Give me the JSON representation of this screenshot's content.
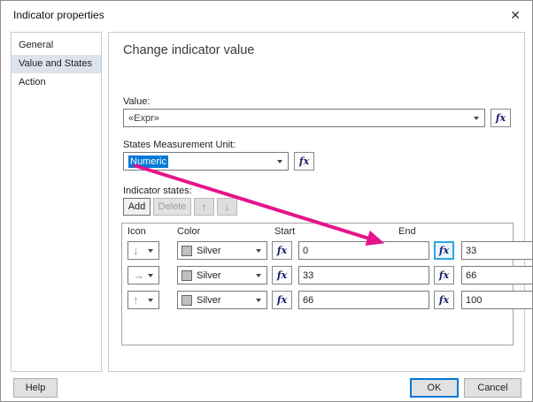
{
  "window": {
    "title": "Indicator properties",
    "close_icon": "✕"
  },
  "sidebar": {
    "items": [
      {
        "label": "General"
      },
      {
        "label": "Value and States"
      },
      {
        "label": "Action"
      }
    ]
  },
  "main": {
    "heading": "Change indicator value",
    "fx_label": "fx",
    "value": {
      "label": "Value:",
      "text": "«Expr»"
    },
    "unit": {
      "label": "States Measurement Unit:",
      "value": "Numeric"
    },
    "states": {
      "label": "Indicator states:",
      "add_label": "Add",
      "delete_label": "Delete",
      "up_icon": "↑",
      "down_icon": "↓",
      "headers": {
        "icon": "Icon",
        "color": "Color",
        "start": "Start",
        "end": "End"
      },
      "rows": [
        {
          "icon_glyph": "↓",
          "color": "Silver",
          "start": "0",
          "end": "33"
        },
        {
          "icon_glyph": "→",
          "color": "Silver",
          "start": "33",
          "end": "66"
        },
        {
          "icon_glyph": "↑",
          "color": "Silver",
          "start": "66",
          "end": "100"
        }
      ]
    }
  },
  "footer": {
    "help_label": "Help",
    "ok_label": "OK",
    "cancel_label": "Cancel"
  },
  "colors": {
    "annotation_arrow": "#e5148c",
    "selection_blue": "#0078d7",
    "silver_swatch": "#c0c0c0",
    "fx_highlight_border": "#2da7e0"
  }
}
